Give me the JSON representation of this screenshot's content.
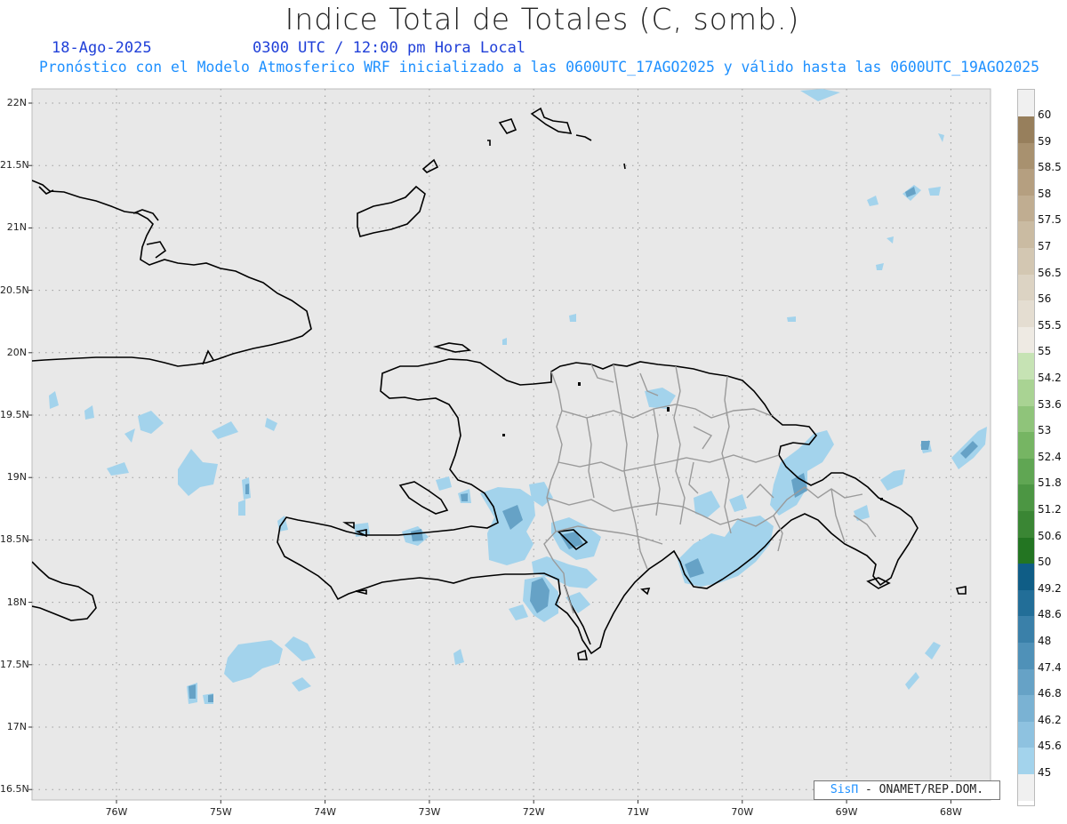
{
  "header": {
    "title": "Indice Total de Totales (C, somb.)",
    "date": "18-Ago-2025",
    "time": "0300 UTC / 12:00 pm Hora Local",
    "subtitle": "Pronóstico con el Modelo Atmosferico WRF inicializado a las 0600UTC_17AGO2025 y válido hasta las  0600UTC_19AGO2025"
  },
  "map": {
    "lat_labels": [
      "22N",
      "21.5N",
      "21N",
      "20.5N",
      "20N",
      "19.5N",
      "19N",
      "18.5N",
      "18N",
      "17.5N",
      "17N",
      "16.5N"
    ],
    "lon_labels": [
      "76W",
      "75W",
      "74W",
      "73W",
      "72W",
      "71W",
      "70W",
      "69W",
      "68W"
    ],
    "background_color": "#e8e8e8",
    "coastline_color": "#000000",
    "province_border_color": "#9a9a9a"
  },
  "colorbar": {
    "labels": [
      "60",
      "59",
      "58.5",
      "58",
      "57.5",
      "57",
      "56.5",
      "56",
      "55.5",
      "55",
      "54.2",
      "53.6",
      "53",
      "52.4",
      "51.8",
      "51.2",
      "50.6",
      "50",
      "49.2",
      "48.6",
      "48",
      "47.4",
      "46.8",
      "46.2",
      "45.6",
      "45"
    ],
    "colors": [
      "#977f5c",
      "#a8916f",
      "#b59f80",
      "#c0ad91",
      "#cabba2",
      "#d3c7b2",
      "#dcd3c3",
      "#e4ddd1",
      "#eeeae3",
      "#c6e3b4",
      "#a9d393",
      "#8fc47a",
      "#76b563",
      "#60a653",
      "#4c9643",
      "#3a8634",
      "#237522",
      "#0f5d86",
      "#226e98",
      "#3a80a9",
      "#4f91b8",
      "#66a2c6",
      "#7ab2d3",
      "#8ec2e0",
      "#a3d3ec",
      "#f0f0f0"
    ],
    "top_color": "#f0f0f0"
  },
  "credit": {
    "sis": "SisΠ",
    "text": " - ONAMET/REP.DOM."
  }
}
